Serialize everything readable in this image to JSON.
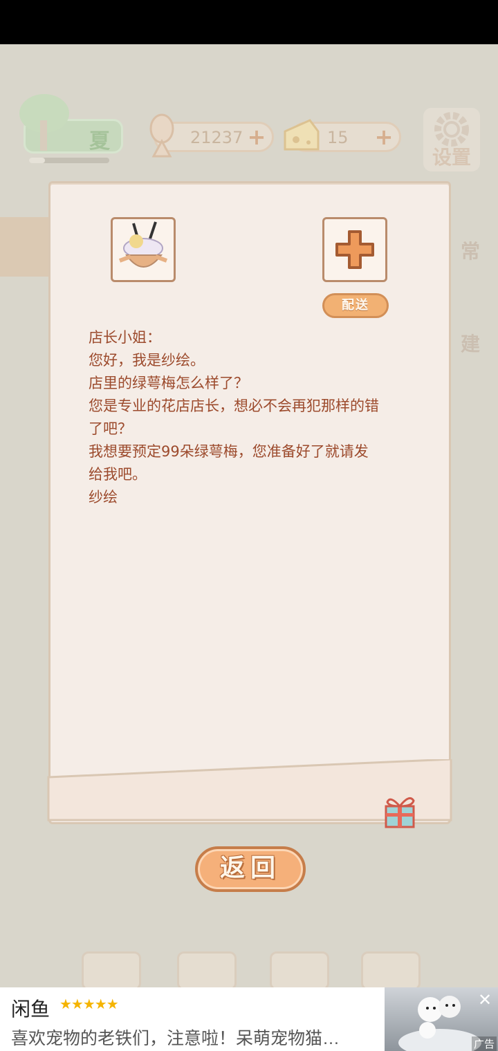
{
  "hud": {
    "season_label": "夏",
    "season_progress": 0.2,
    "fish_currency": "21237",
    "cheese_currency": "15",
    "plus_symbol": "+",
    "settings_label": "设置",
    "side_daily_label": "常",
    "side_build_label": "建"
  },
  "letter": {
    "deliver_label": "配送",
    "lines": [
      "店长小姐：",
      "您好，我是纱绘。",
      "店里的绿萼梅怎么样了？",
      "您是专业的花店店长，想必不会再犯那样的错",
      "了吧？",
      "我想要预定99朵绿萼梅，您准备好了就请发",
      "给我吧。",
      "纱绘"
    ],
    "back_label": "返回"
  },
  "ad": {
    "brand": "闲鱼",
    "stars": "★★★★★",
    "description": "喜欢宠物的老铁们，注意啦！呆萌宠物猫…",
    "close": "✕",
    "tag": "广告"
  },
  "colors": {
    "letter_text": "#9c4a2c",
    "button_orange": "#f5b07a",
    "paper": "#f5ede7"
  }
}
